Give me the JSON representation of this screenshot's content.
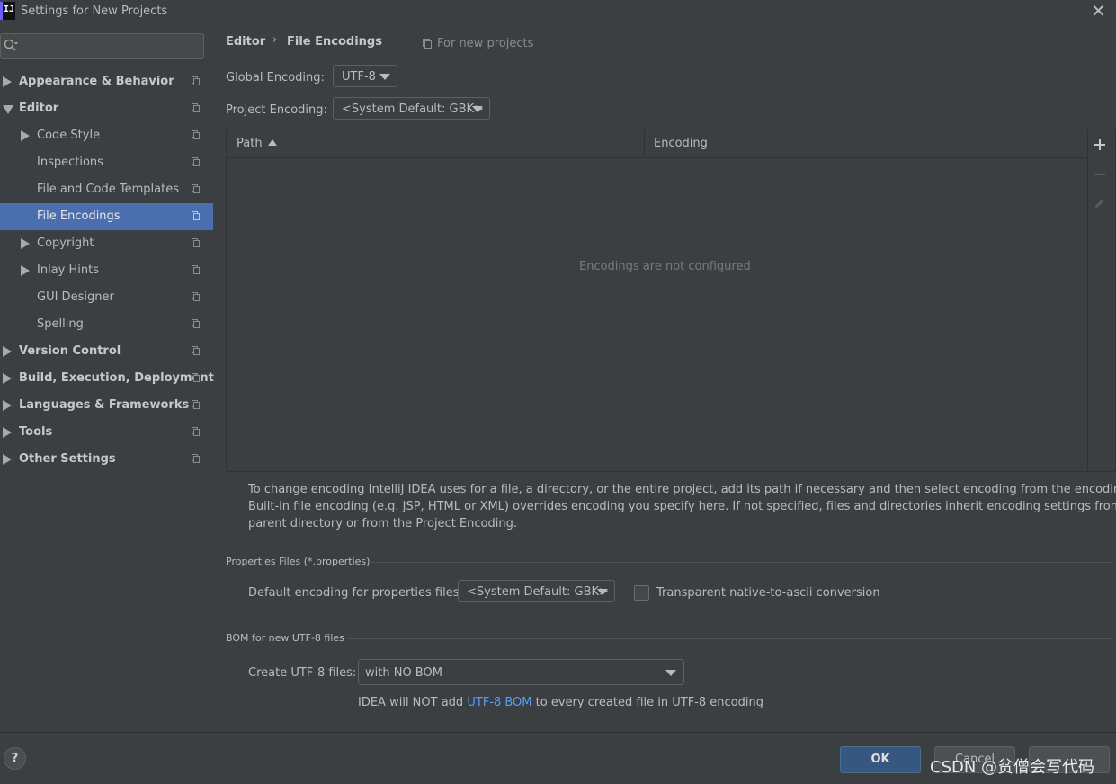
{
  "window": {
    "title": "Settings for New Projects",
    "app_icon_letters": "IJ"
  },
  "search": {
    "placeholder": ""
  },
  "sidebar": {
    "items": [
      {
        "label": "Appearance & Behavior"
      },
      {
        "label": "Editor"
      },
      {
        "label": "Code Style"
      },
      {
        "label": "Inspections"
      },
      {
        "label": "File and Code Templates"
      },
      {
        "label": "File Encodings",
        "selected": true
      },
      {
        "label": "Copyright"
      },
      {
        "label": "Inlay Hints"
      },
      {
        "label": "GUI Designer"
      },
      {
        "label": "Spelling"
      },
      {
        "label": "Version Control"
      },
      {
        "label": "Build, Execution, Deployment"
      },
      {
        "label": "Languages & Frameworks"
      },
      {
        "label": "Tools"
      },
      {
        "label": "Other Settings"
      }
    ]
  },
  "breadcrumb": {
    "parent": "Editor",
    "separator": "›",
    "current": "File Encodings",
    "scope": "For new projects"
  },
  "global_encoding": {
    "label": "Global Encoding:",
    "value": "UTF-8"
  },
  "project_encoding": {
    "label": "Project Encoding:",
    "value": "<System Default: GBK>"
  },
  "table": {
    "columns": [
      "Path",
      "Encoding"
    ],
    "empty_text": "Encodings are not configured",
    "tools": {
      "add": "+",
      "remove": "−",
      "edit": "edit"
    }
  },
  "info_text": {
    "line1": "To change encoding IntelliJ IDEA uses for a file, a directory, or the entire project, add its path if necessary and then select encoding from the encoding list.",
    "line2": "Built-in file encoding (e.g. JSP, HTML or XML) overrides encoding you specify here. If not specified, files and directories inherit encoding settings from the",
    "line3": "parent directory or from the Project Encoding."
  },
  "properties": {
    "section_title": "Properties Files (*.properties)",
    "default_label": "Default encoding for properties files:",
    "default_value": "<System Default: GBK>",
    "native_label": "Transparent native-to-ascii conversion",
    "native_checked": false
  },
  "bom": {
    "section_title": "BOM for new UTF-8 files",
    "create_label": "Create UTF-8 files:",
    "create_value": "with NO BOM",
    "note_before": "IDEA will NOT add ",
    "note_link": "UTF-8 BOM",
    "note_after": " to every created file in UTF-8 encoding"
  },
  "footer": {
    "help": "?",
    "ok": "OK",
    "cancel": "Cancel",
    "apply": "",
    "watermark": "CSDN @贫僧会写代码"
  },
  "colors": {
    "accent": "#4b6eaf",
    "link": "#589df6",
    "ok_button": "#365880"
  }
}
